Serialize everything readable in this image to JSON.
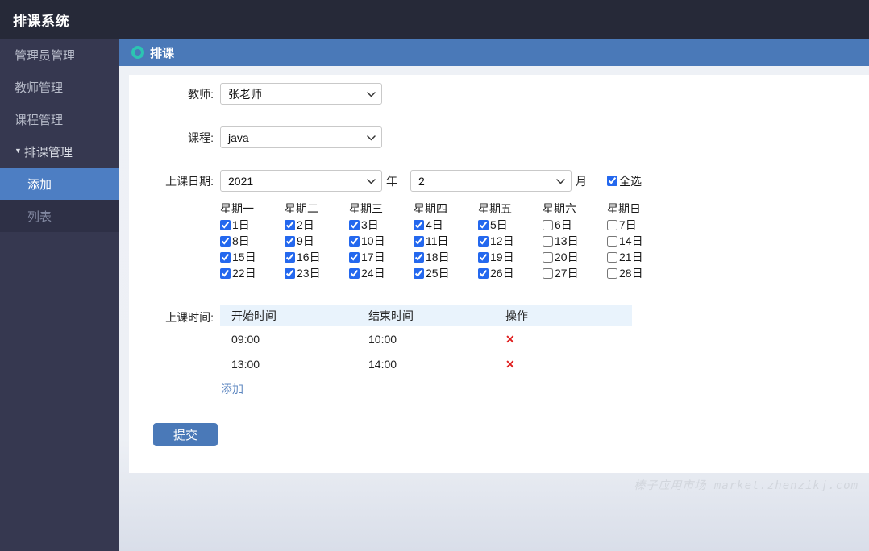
{
  "app": {
    "title": "排课系统"
  },
  "sidebar": {
    "items": [
      {
        "label": "管理员管理"
      },
      {
        "label": "教师管理"
      },
      {
        "label": "课程管理"
      },
      {
        "label": "排课管理",
        "arrow": "▼",
        "expanded": true
      }
    ],
    "submenu": [
      {
        "label": "添加",
        "active": true
      },
      {
        "label": "列表",
        "active": false
      }
    ]
  },
  "content_header": {
    "title": "排课"
  },
  "form": {
    "teacher": {
      "label": "教师:",
      "value": "张老师"
    },
    "course": {
      "label": "课程:",
      "value": "java"
    },
    "date": {
      "label": "上课日期:",
      "year": "2021",
      "year_suffix": "年",
      "month": "2",
      "month_suffix": "月",
      "select_all": {
        "label": "全选",
        "checked": true
      }
    },
    "calendar": {
      "weekdays": [
        "星期一",
        "星期二",
        "星期三",
        "星期四",
        "星期五",
        "星期六",
        "星期日"
      ],
      "days": [
        {
          "label": "1日",
          "checked": true
        },
        {
          "label": "2日",
          "checked": true
        },
        {
          "label": "3日",
          "checked": true
        },
        {
          "label": "4日",
          "checked": true
        },
        {
          "label": "5日",
          "checked": true
        },
        {
          "label": "6日",
          "checked": false
        },
        {
          "label": "7日",
          "checked": false
        },
        {
          "label": "8日",
          "checked": true
        },
        {
          "label": "9日",
          "checked": true
        },
        {
          "label": "10日",
          "checked": true
        },
        {
          "label": "11日",
          "checked": true
        },
        {
          "label": "12日",
          "checked": true
        },
        {
          "label": "13日",
          "checked": false
        },
        {
          "label": "14日",
          "checked": false
        },
        {
          "label": "15日",
          "checked": true
        },
        {
          "label": "16日",
          "checked": true
        },
        {
          "label": "17日",
          "checked": true
        },
        {
          "label": "18日",
          "checked": true
        },
        {
          "label": "19日",
          "checked": true
        },
        {
          "label": "20日",
          "checked": false
        },
        {
          "label": "21日",
          "checked": false
        },
        {
          "label": "22日",
          "checked": true
        },
        {
          "label": "23日",
          "checked": true
        },
        {
          "label": "24日",
          "checked": true
        },
        {
          "label": "25日",
          "checked": true
        },
        {
          "label": "26日",
          "checked": true
        },
        {
          "label": "27日",
          "checked": false
        },
        {
          "label": "28日",
          "checked": false
        }
      ]
    },
    "time": {
      "label": "上课时间:",
      "table": {
        "headers": [
          "开始时间",
          "结束时间",
          "操作"
        ],
        "rows": [
          {
            "start": "09:00",
            "end": "10:00",
            "delete_icon": "✕"
          },
          {
            "start": "13:00",
            "end": "14:00",
            "delete_icon": "✕"
          }
        ]
      },
      "add_label": "添加"
    },
    "submit_label": "提交"
  },
  "footer": {
    "watermark": "榛子应用市场 market.zhenzikj.com"
  },
  "colors": {
    "top_header_bg": "#262938",
    "sidebar_bg": "#363850",
    "submenu_bg": "#2e3046",
    "active_item_blue": "#4d7ec3",
    "accent_blue": "#4a79b8",
    "ring_icon_teal": "#2cc4b2",
    "checkbox_accent": "#2468ee",
    "table_header_bg": "#e9f3fc",
    "delete_red": "#e02020",
    "link_blue": "#5e87c0"
  }
}
